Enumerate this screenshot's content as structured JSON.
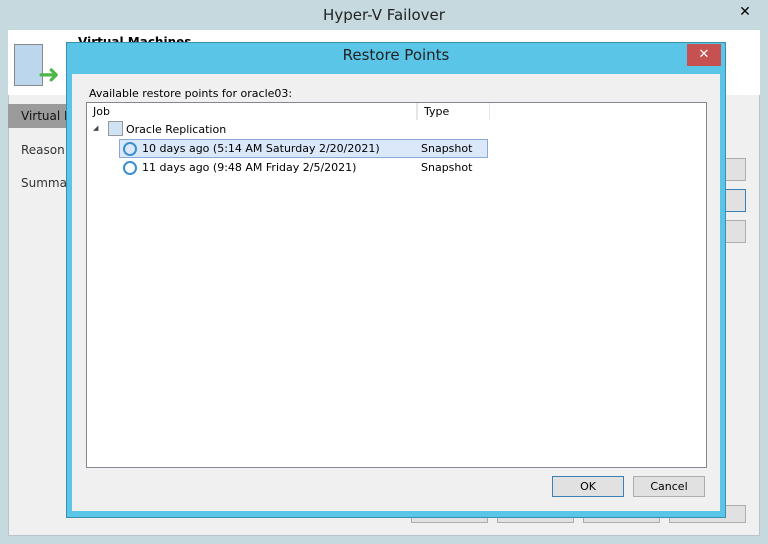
{
  "window": {
    "title": "Hyper-V Failover",
    "close_glyph": "✕"
  },
  "wizard": {
    "header_title": "Virtual Machines",
    "nav": [
      "Virtual Machines",
      "Reason",
      "Summary"
    ]
  },
  "dialog": {
    "title": "Restore Points",
    "close_glyph": "✕",
    "label": "Available restore points for oracle03:",
    "columns": [
      "Job",
      "Type"
    ],
    "job": {
      "name": "Oracle Replication",
      "expand_glyph": "◢"
    },
    "points": [
      {
        "label": "10  days ago (5:14 AM Saturday 2/20/2021)",
        "type": "Snapshot",
        "selected": true
      },
      {
        "label": "11  days ago (9:48 AM Friday 2/5/2021)",
        "type": "Snapshot",
        "selected": false
      }
    ],
    "ok": "OK",
    "cancel": "Cancel"
  }
}
